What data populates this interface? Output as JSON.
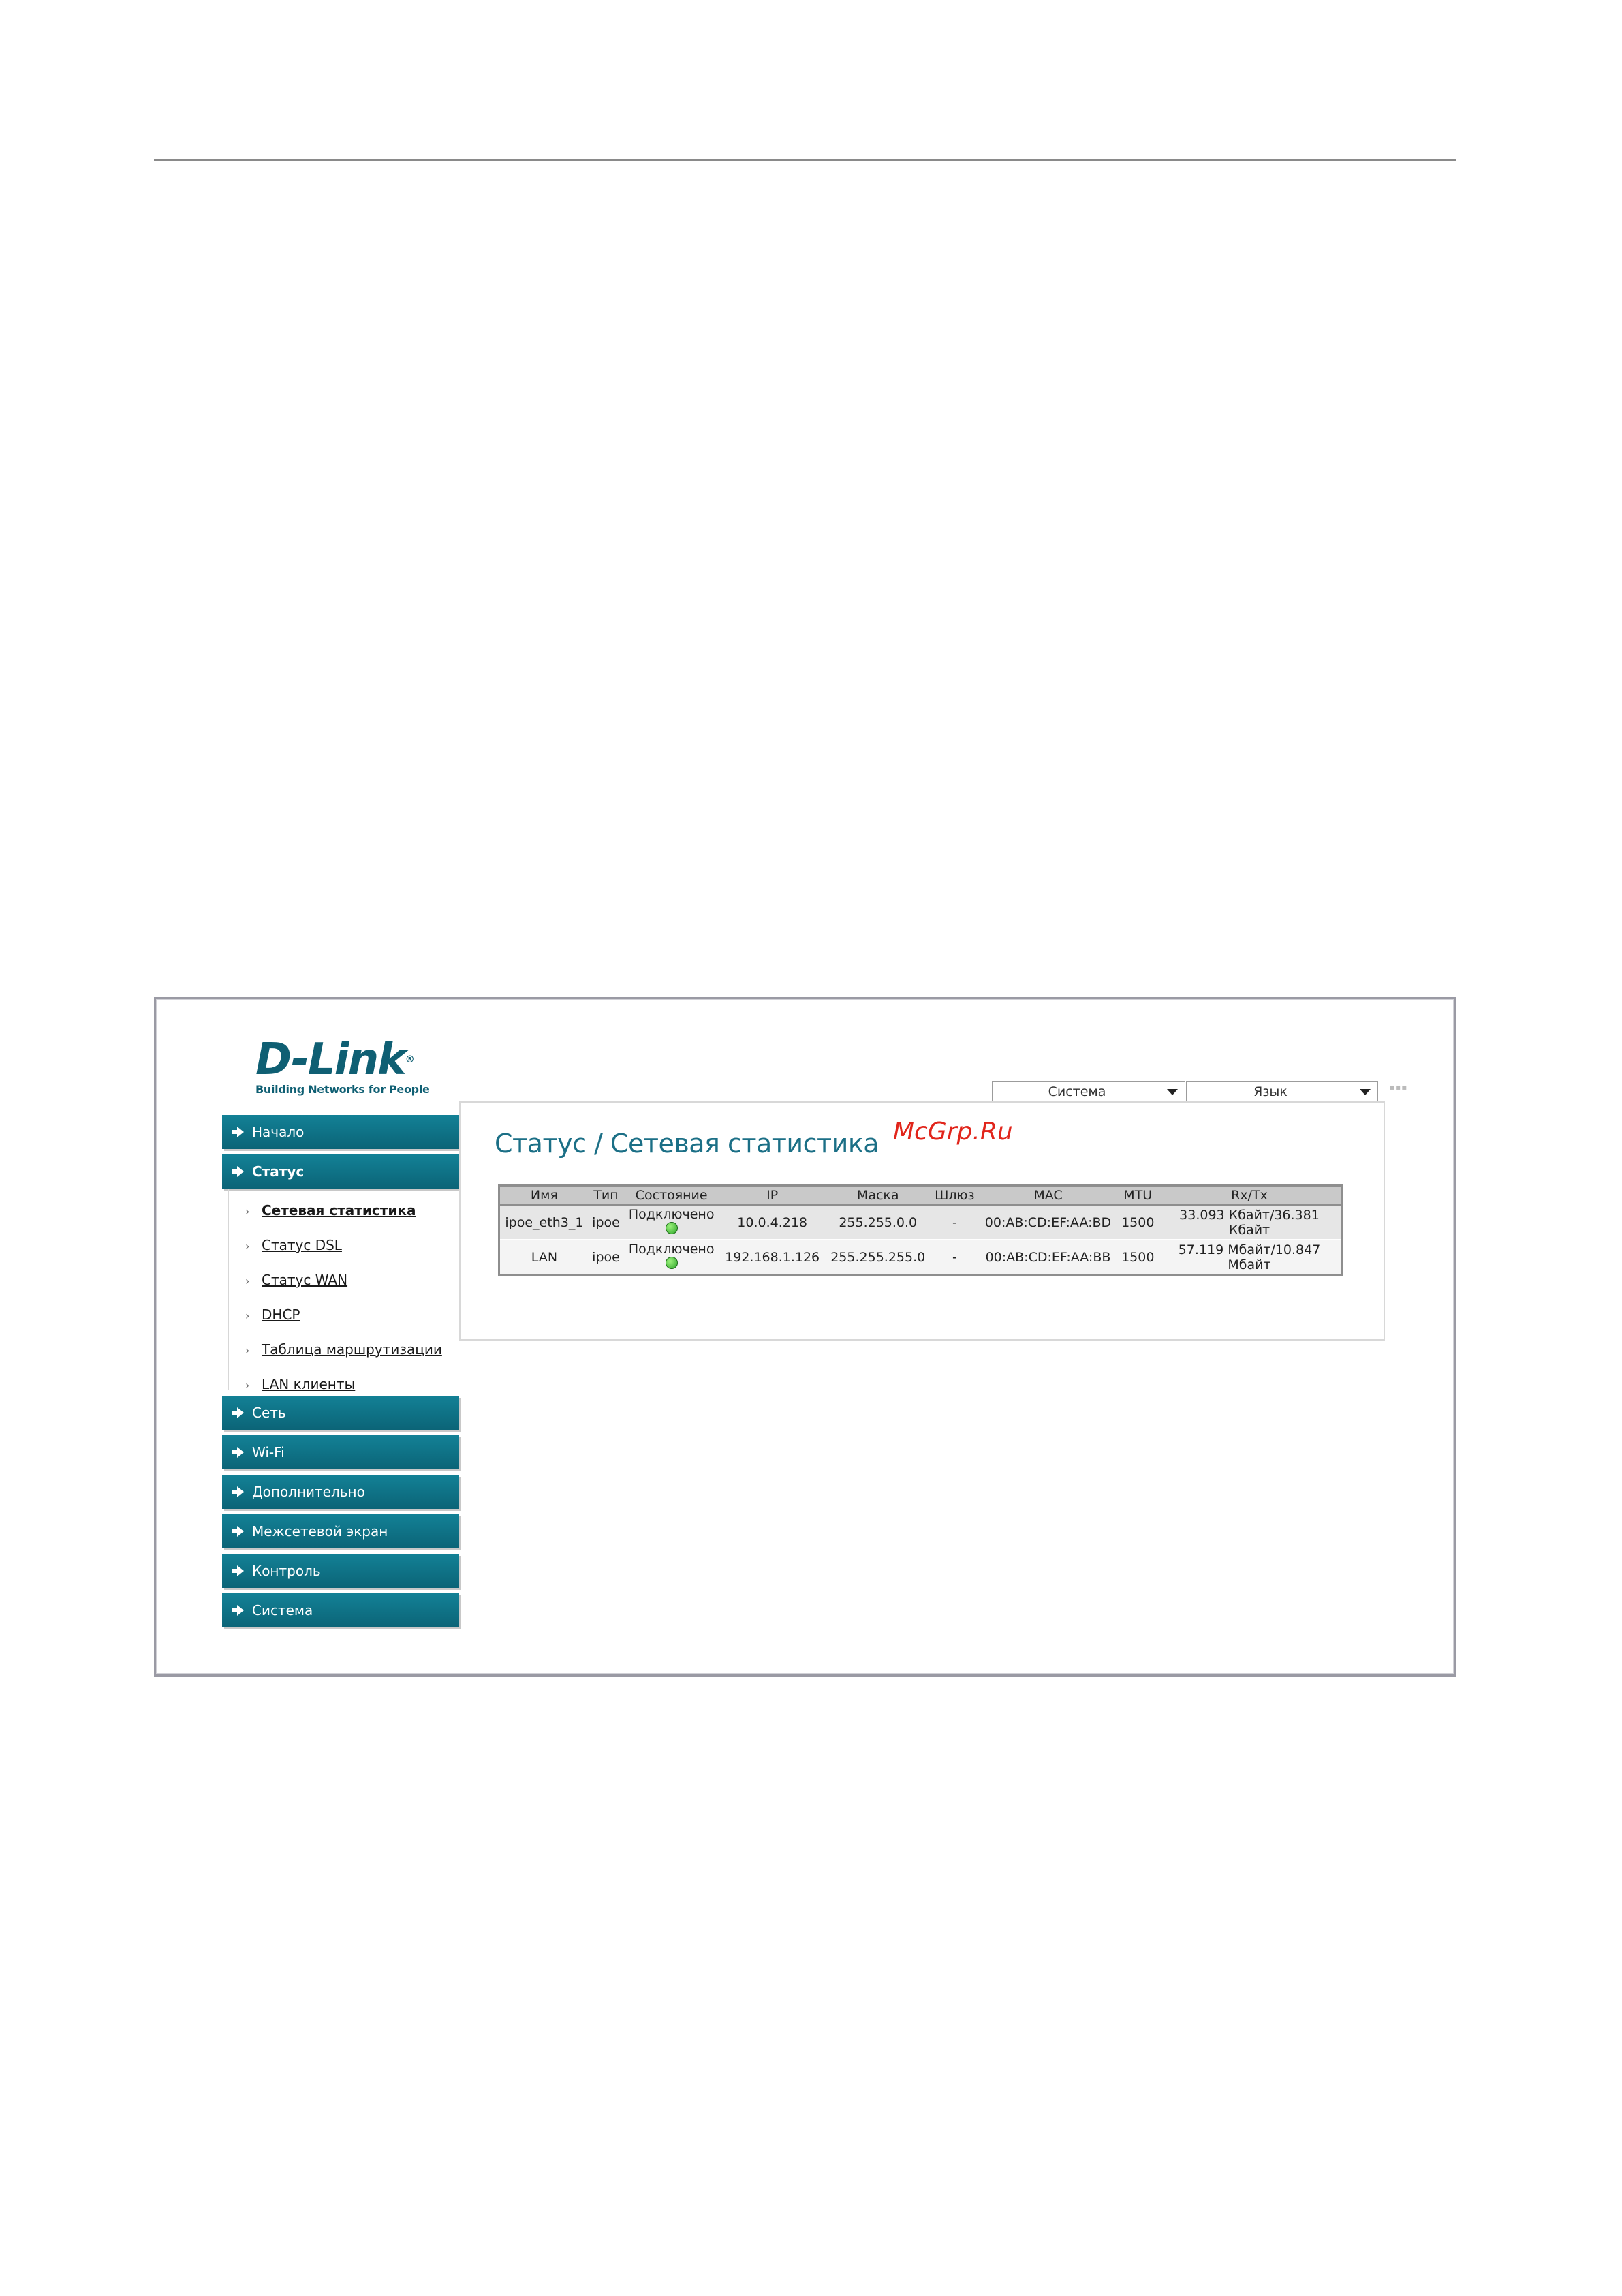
{
  "brand": {
    "logo_text": "D-Link",
    "logo_reg": "®",
    "tagline": "Building Networks for People"
  },
  "watermark": "McGrp.Ru",
  "top_menu": {
    "system_label": "Система",
    "language_label": "Язык",
    "corner_dots": "▪▪▪"
  },
  "page": {
    "title": "Статус / Сетевая статистика"
  },
  "sidebar": {
    "items": [
      {
        "label": "Начало"
      },
      {
        "label": "Статус"
      },
      {
        "label": "Сеть"
      },
      {
        "label": "Wi-Fi"
      },
      {
        "label": "Дополнительно"
      },
      {
        "label": "Межсетевой экран"
      },
      {
        "label": "Контроль"
      },
      {
        "label": "Система"
      }
    ],
    "status_submenu": [
      {
        "label": "Сетевая статистика",
        "active": true
      },
      {
        "label": "Статус DSL"
      },
      {
        "label": "Статус WAN"
      },
      {
        "label": "DHCP"
      },
      {
        "label": "Таблица маршрутизации"
      },
      {
        "label": "LAN клиенты"
      }
    ]
  },
  "table": {
    "headers": [
      "Имя",
      "Тип",
      "Состояние",
      "IP",
      "Маска",
      "Шлюз",
      "MAC",
      "MTU",
      "Rx/Tx"
    ],
    "rows": [
      {
        "name": "ipoe_eth3_1",
        "type": "ipoe",
        "state": "Подключено",
        "ip": "10.0.4.218",
        "mask": "255.255.0.0",
        "gateway": "-",
        "mac": "00:AB:CD:EF:AA:BD",
        "mtu": "1500",
        "rxtx": "33.093 Кбайт/36.381 Кбайт"
      },
      {
        "name": "LAN",
        "type": "ipoe",
        "state": "Подключено",
        "ip": "192.168.1.126",
        "mask": "255.255.255.0",
        "gateway": "-",
        "mac": "00:AB:CD:EF:AA:BB",
        "mtu": "1500",
        "rxtx": "57.119 Мбайт/10.847 Мбайт"
      }
    ],
    "status_color": "#2ea52a"
  },
  "colors": {
    "nav_bg": "#0f7488",
    "title": "#1b6f86",
    "watermark": "#e1251b"
  }
}
